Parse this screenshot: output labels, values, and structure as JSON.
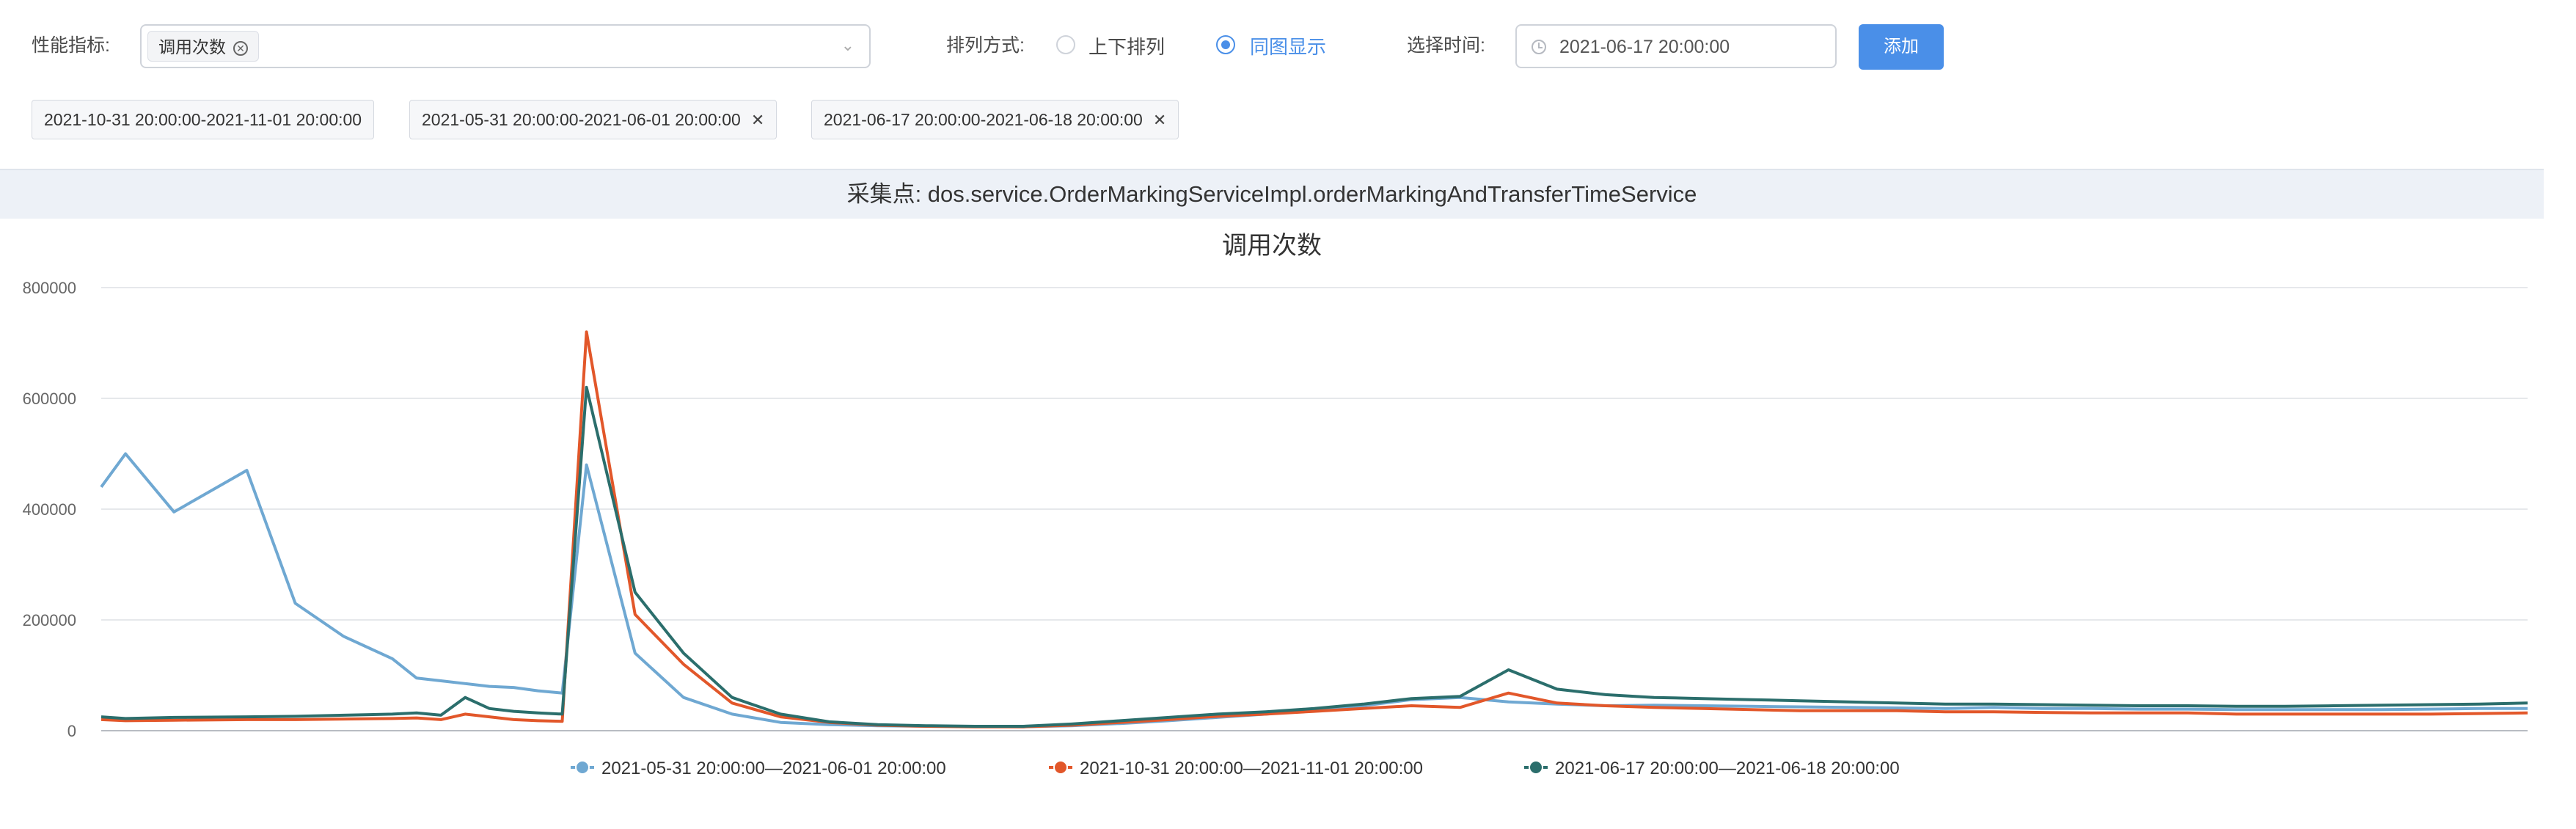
{
  "filters": {
    "metric_label": "性能指标:",
    "metric_tag": "调用次数",
    "sort_label": "排列方式:",
    "sort_options": [
      "上下排列",
      "同图显示"
    ],
    "sort_selected": "同图显示",
    "time_label": "选择时间:",
    "time_value": "2021-06-17 20:00:00",
    "add_label": "添加"
  },
  "range_tags": [
    {
      "label": "2021-10-31 20:00:00-2021-11-01 20:00:00",
      "closable": false
    },
    {
      "label": "2021-05-31 20:00:00-2021-06-01 20:00:00",
      "closable": true
    },
    {
      "label": "2021-06-17 20:00:00-2021-06-18 20:00:00",
      "closable": true
    }
  ],
  "collect_point": "采集点:  dos.service.OrderMarkingServiceImpl.orderMarkingAndTransferTimeService",
  "colors": {
    "primary": "#4a8fe8",
    "series1": "#6fa8d2",
    "series2": "#e2572a",
    "series3": "#2b6e6c"
  },
  "chart_data": {
    "type": "line",
    "title": "调用次数",
    "xlabel": "",
    "ylabel": "",
    "ylim": [
      0,
      800000
    ],
    "y_ticks": [
      "0",
      "200000",
      "400000",
      "600000",
      "800000"
    ],
    "grid": true,
    "legend_position": "bottom",
    "x": [
      0,
      1,
      3,
      6,
      8,
      10,
      12,
      13,
      14,
      15,
      16,
      17,
      18,
      19,
      20,
      22,
      24,
      26,
      28,
      30,
      32,
      34,
      36,
      38,
      40,
      42,
      44,
      46,
      48,
      50,
      52,
      54,
      56,
      58,
      60,
      62,
      64,
      66,
      68,
      70,
      72,
      74,
      76,
      78,
      80,
      82,
      84,
      86,
      88,
      90,
      92,
      94,
      96,
      98,
      100
    ],
    "series": [
      {
        "name": "2021-05-31 20:00:00—2021-06-01 20:00:00",
        "color": "#6fa8d2",
        "values": [
          440000,
          500000,
          395000,
          470000,
          230000,
          170000,
          130000,
          95000,
          90000,
          85000,
          80000,
          78000,
          72000,
          68000,
          480000,
          140000,
          60000,
          30000,
          15000,
          11000,
          9000,
          8000,
          8000,
          7000,
          9000,
          13000,
          18000,
          24000,
          30000,
          38000,
          45000,
          56000,
          60000,
          52000,
          48000,
          45000,
          46000,
          45000,
          44000,
          43000,
          42000,
          41000,
          40000,
          42000,
          40000,
          40000,
          39000,
          39000,
          38000,
          38000,
          38000,
          38000,
          39000,
          40000,
          40000
        ]
      },
      {
        "name": "2021-10-31 20:00:00—2021-11-01 20:00:00",
        "color": "#e2572a",
        "values": [
          20000,
          18000,
          19000,
          20000,
          20000,
          21000,
          22000,
          23000,
          20000,
          30000,
          25000,
          20000,
          18000,
          17000,
          720000,
          210000,
          120000,
          50000,
          25000,
          15000,
          10000,
          8000,
          7000,
          7000,
          10000,
          15000,
          20000,
          26000,
          30000,
          35000,
          40000,
          45000,
          42000,
          68000,
          50000,
          45000,
          42000,
          40000,
          38000,
          36000,
          36000,
          36000,
          34000,
          34000,
          33000,
          32000,
          32000,
          32000,
          30000,
          30000,
          30000,
          30000,
          30000,
          31000,
          32000
        ]
      },
      {
        "name": "2021-06-17 20:00:00—2021-06-18 20:00:00",
        "color": "#2b6e6c",
        "values": [
          25000,
          22000,
          24000,
          25000,
          26000,
          28000,
          30000,
          32000,
          28000,
          60000,
          40000,
          35000,
          32000,
          30000,
          620000,
          250000,
          140000,
          60000,
          30000,
          16000,
          11000,
          9000,
          8000,
          8000,
          12000,
          18000,
          24000,
          30000,
          34000,
          40000,
          48000,
          58000,
          62000,
          110000,
          75000,
          65000,
          60000,
          58000,
          56000,
          54000,
          52000,
          50000,
          48000,
          48000,
          47000,
          46000,
          45000,
          45000,
          44000,
          44000,
          45000,
          46000,
          47000,
          48000,
          50000
        ]
      }
    ]
  }
}
